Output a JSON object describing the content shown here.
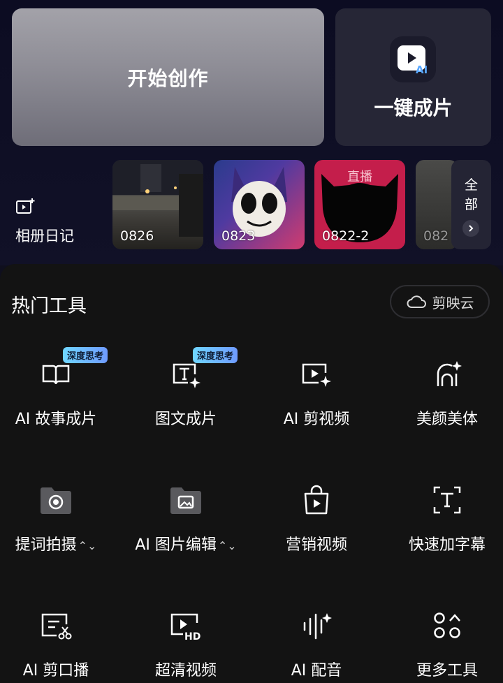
{
  "hero": {
    "start_label": "开始创作",
    "oneclick_label": "一键成片",
    "oneclick_icon": "ai-video-icon"
  },
  "album": {
    "label": "相册日记",
    "icon": "album-plus-icon"
  },
  "thumbnails": [
    {
      "label": "0826"
    },
    {
      "label": "0823"
    },
    {
      "label": "0822-2",
      "tag": "直播"
    },
    {
      "label": "082"
    }
  ],
  "all_button": {
    "line1": "全",
    "line2": "部"
  },
  "tools_panel": {
    "title": "热门工具",
    "cloud_label": "剪映云",
    "tools": [
      {
        "label": "AI 故事成片",
        "badge": "深度思考",
        "icon": "book-icon"
      },
      {
        "label": "图文成片",
        "badge": "深度思考",
        "icon": "text-image-icon"
      },
      {
        "label": "AI 剪视频",
        "icon": "play-sparkle-icon"
      },
      {
        "label": "美颜美体",
        "icon": "face-sparkle-icon"
      },
      {
        "label": "提词拍摄",
        "icon": "teleprompter-folder-icon"
      },
      {
        "label": "AI 图片编辑",
        "icon": "image-folder-icon"
      },
      {
        "label": "营销视频",
        "icon": "shopping-bag-icon"
      },
      {
        "label": "快速加字幕",
        "icon": "subtitle-icon"
      },
      {
        "label": "AI 剪口播",
        "icon": "caption-cut-icon"
      },
      {
        "label": "超清视频",
        "icon": "hd-video-icon"
      },
      {
        "label": "AI 配音",
        "icon": "voice-wave-icon"
      },
      {
        "label": "更多工具",
        "icon": "more-grid-icon"
      }
    ]
  },
  "colors": {
    "background": "#0f0f1e",
    "panel": "#131313",
    "badge_gradient_start": "#6fd6ff",
    "badge_gradient_end": "#6f9bff",
    "live_card": "#c41e4b"
  }
}
